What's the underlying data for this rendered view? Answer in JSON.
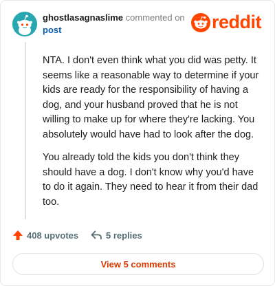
{
  "comment": {
    "username": "ghostlasagnaslime",
    "action_text": "commented on",
    "target_link": "post",
    "avatar_icon": "snoo-avatar-icon",
    "paragraphs": [
      "NTA. I don't even think what you did was petty. It seems like a reasonable way to determine if your kids are ready for the responsibility of having a dog, and your husband proved that he is not willing to make up for where they're lacking. You absolutely would have had to look after the dog.",
      "You already told the kids you don't think they should have a dog. I don't know why you'd have to do it again. They need to hear it from their dad too."
    ]
  },
  "brand": {
    "logo_text": "reddit",
    "logo_icon": "reddit-alien-icon",
    "accent_color": "#ff4500"
  },
  "actions": {
    "upvotes_label": "408 upvotes",
    "upvote_icon": "upvote-arrow-icon",
    "replies_label": "5 replies",
    "reply_icon": "reply-arrow-icon"
  },
  "footer": {
    "view_comments_label": "View 5 comments",
    "link_color": "#d93a00"
  }
}
